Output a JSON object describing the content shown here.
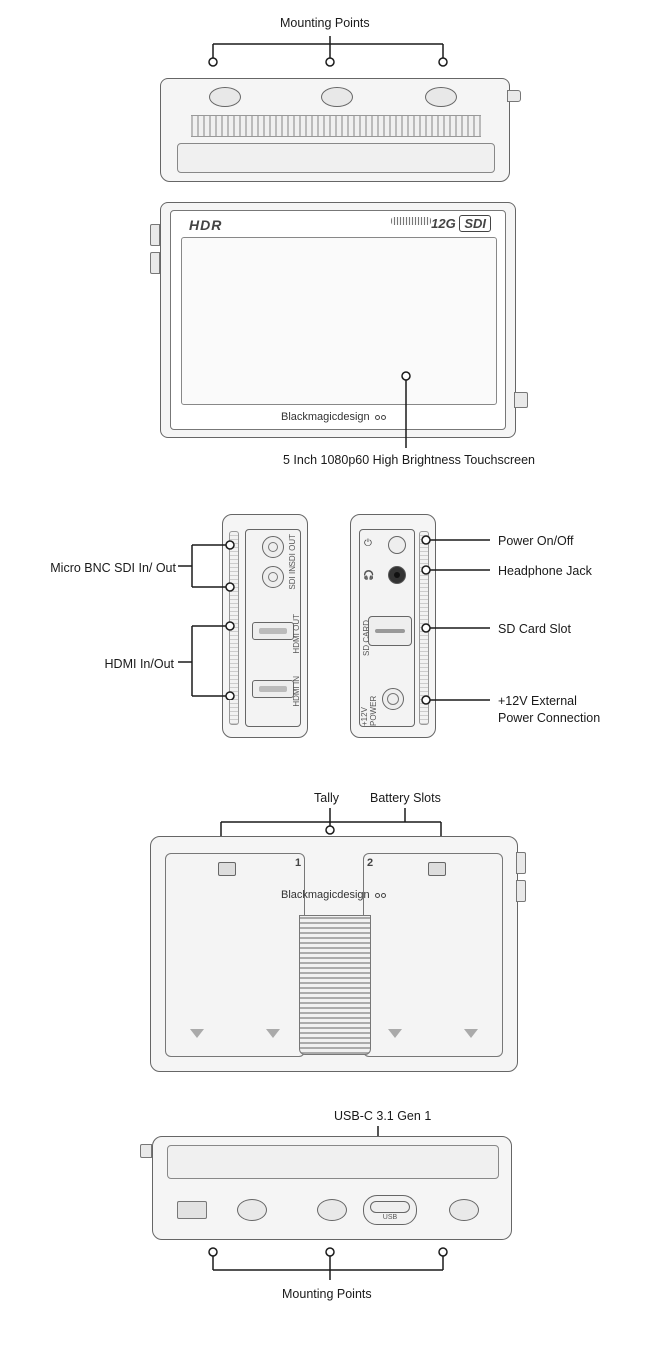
{
  "labels": {
    "mounting_points_top": "Mounting Points",
    "mounting_points_bottom": "Mounting Points",
    "touchscreen": "5 Inch 1080p60 High Brightness Touchscreen",
    "bnc": "Micro BNC SDI In/ Out",
    "hdmi": "HDMI In/Out",
    "power": "Power On/Off",
    "headphone": "Headphone Jack",
    "sd": "SD Card Slot",
    "ext_power": "+12V External\nPower Connection",
    "tally": "Tally",
    "battery": "Battery Slots",
    "usb": "USB-C 3.1 Gen 1"
  },
  "device_text": {
    "hdr_logo": "HDR",
    "sdi_logo_prefix": "12G",
    "sdi_logo_box": "SDI",
    "brand": "Blackmagicdesign",
    "sdi_in": "SDI IN",
    "sdi_out": "SDI OUT",
    "hdmi_in": "HDMI IN",
    "hdmi_out": "HDMI OUT",
    "power_icon": "⏻",
    "hp_icon": "🎧",
    "sd_card": "SD CARD",
    "pwr12": "+12V POWER",
    "slot1": "1",
    "slot2": "2",
    "usb_port": "USB"
  }
}
